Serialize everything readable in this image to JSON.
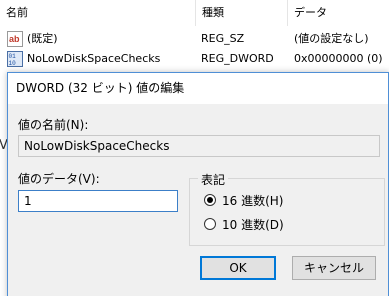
{
  "registry": {
    "columns": {
      "name": "名前",
      "type": "種類",
      "data": "データ"
    },
    "rows": [
      {
        "name": "(既定)",
        "type": "REG_SZ",
        "data": "(値の設定なし)",
        "icon": "string-value-icon"
      },
      {
        "name": "NoLowDiskSpaceChecks",
        "type": "REG_DWORD",
        "data": "0x00000000 (0)",
        "icon": "dword-value-icon"
      }
    ],
    "partial_letter": "V"
  },
  "dialog": {
    "title": "DWORD (32 ビット) 値の編集",
    "name_label": "値の名前(N):",
    "name_value": "NoLowDiskSpaceChecks",
    "data_label": "値のデータ(V):",
    "data_value": "1",
    "base_legend": "表記",
    "radio_hex": "16 進数(H)",
    "radio_dec": "10 進数(D)",
    "selected_base": "hex",
    "ok_label": "OK",
    "cancel_label": "キャンセル"
  }
}
